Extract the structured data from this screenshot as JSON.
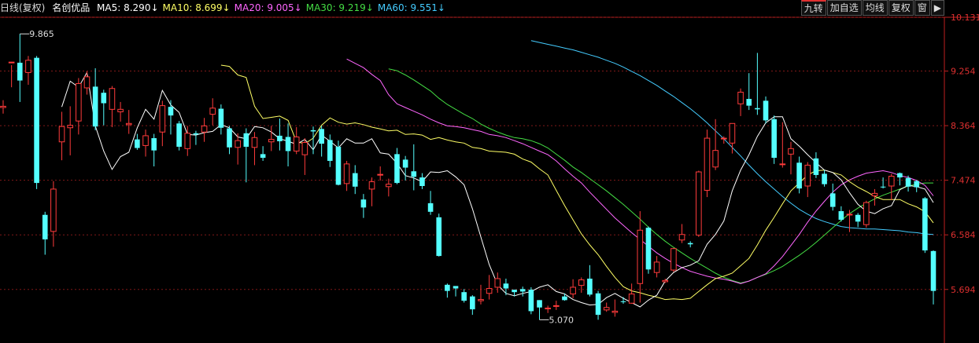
{
  "header": {
    "title": "日线(复权)",
    "stock": "名创优品",
    "ma": [
      {
        "label": "MA5:",
        "value": "8.290",
        "arrow": "↓",
        "color": "#ffffff"
      },
      {
        "label": "MA10:",
        "value": "8.699",
        "arrow": "↓",
        "color": "#ffff66"
      },
      {
        "label": "MA20:",
        "value": "9.005",
        "arrow": "↓",
        "color": "#ff66ff"
      },
      {
        "label": "MA30:",
        "value": "9.219",
        "arrow": "↓",
        "color": "#44dd44"
      },
      {
        "label": "MA60:",
        "value": "9.551",
        "arrow": "↓",
        "color": "#44ccff"
      }
    ]
  },
  "toolbar": [
    "九转",
    "加自选",
    "均线",
    "复权",
    "窗",
    "▶"
  ],
  "colors": {
    "up": "#ff3b3b",
    "down": "#54ffff",
    "axis": "#c02020",
    "grid": "#801818"
  },
  "chart_data": {
    "type": "candlestick",
    "ylim": [
      5.0,
      10.131
    ],
    "yticks": [
      "10.131",
      "9.254",
      "8.364",
      "7.474",
      "6.584",
      "5.694"
    ],
    "annotations": {
      "high": "9.865",
      "low": "5.070"
    },
    "candles": [
      [
        8.66,
        8.68,
        8.56,
        8.78
      ],
      [
        9.39,
        9.4,
        8.99,
        9.35
      ],
      [
        9.39,
        9.1,
        8.75,
        9.86
      ],
      [
        9.23,
        9.43,
        9.03,
        9.5
      ],
      [
        9.47,
        7.43,
        7.33,
        9.5
      ],
      [
        6.91,
        6.51,
        6.26,
        6.96
      ],
      [
        6.64,
        7.33,
        6.39,
        7.46
      ],
      [
        8.1,
        8.35,
        7.8,
        8.59
      ],
      [
        8.33,
        8.37,
        7.88,
        8.68
      ],
      [
        8.44,
        9.05,
        8.22,
        9.14
      ],
      [
        8.98,
        9.16,
        8.87,
        9.25
      ],
      [
        9.0,
        8.35,
        8.29,
        9.3
      ],
      [
        8.9,
        8.73,
        8.37,
        8.95
      ],
      [
        8.63,
        8.97,
        8.34,
        9.01
      ],
      [
        8.59,
        8.63,
        8.43,
        8.75
      ],
      [
        8.38,
        8.4,
        8.23,
        8.62
      ],
      [
        8.14,
        8.0,
        7.97,
        8.23
      ],
      [
        8.04,
        8.2,
        7.86,
        8.3
      ],
      [
        8.16,
        7.96,
        7.7,
        8.23
      ],
      [
        8.26,
        8.69,
        8.03,
        8.77
      ],
      [
        8.67,
        8.53,
        8.22,
        8.78
      ],
      [
        8.4,
        8.02,
        7.96,
        8.44
      ],
      [
        7.99,
        8.24,
        7.87,
        8.36
      ],
      [
        8.24,
        8.22,
        8.05,
        8.28
      ],
      [
        8.26,
        8.36,
        8.1,
        8.49
      ],
      [
        8.55,
        8.65,
        8.37,
        8.81
      ],
      [
        8.64,
        8.33,
        8.22,
        8.71
      ],
      [
        8.32,
        8.01,
        7.9,
        8.36
      ],
      [
        8.01,
        8.12,
        7.73,
        8.24
      ],
      [
        8.24,
        8.02,
        7.44,
        8.32
      ],
      [
        8.01,
        8.17,
        7.72,
        8.26
      ],
      [
        7.9,
        7.84,
        7.79,
        8.03
      ],
      [
        8.1,
        8.14,
        7.95,
        8.36
      ],
      [
        8.2,
        8.11,
        7.96,
        8.48
      ],
      [
        8.18,
        7.95,
        7.7,
        8.4
      ],
      [
        7.95,
        8.18,
        7.9,
        8.34
      ],
      [
        7.89,
        8.09,
        7.56,
        8.16
      ],
      [
        8.29,
        8.27,
        7.9,
        8.35
      ],
      [
        8.31,
        8.07,
        7.86,
        8.36
      ],
      [
        8.13,
        7.79,
        7.69,
        8.22
      ],
      [
        8.02,
        7.4,
        7.39,
        8.12
      ],
      [
        7.42,
        7.74,
        7.3,
        7.79
      ],
      [
        7.59,
        7.37,
        7.25,
        7.72
      ],
      [
        7.16,
        7.03,
        6.86,
        7.25
      ],
      [
        7.33,
        7.45,
        7.05,
        7.52
      ],
      [
        7.56,
        7.57,
        7.47,
        7.7
      ],
      [
        7.37,
        7.41,
        7.21,
        7.5
      ],
      [
        7.9,
        7.43,
        7.41,
        8.0
      ],
      [
        7.81,
        7.68,
        7.47,
        7.87
      ],
      [
        7.62,
        7.53,
        7.31,
        8.06
      ],
      [
        7.52,
        7.38,
        7.33,
        7.59
      ],
      [
        7.1,
        6.96,
        6.91,
        7.3
      ],
      [
        6.87,
        6.24,
        6.23,
        6.93
      ],
      [
        5.77,
        5.67,
        5.56,
        5.79
      ],
      [
        5.75,
        5.71,
        5.58,
        5.73
      ],
      [
        5.65,
        5.51,
        5.48,
        5.7
      ],
      [
        5.58,
        5.37,
        5.28,
        5.6
      ],
      [
        5.51,
        5.53,
        5.45,
        5.77
      ],
      [
        5.63,
        5.71,
        5.53,
        5.93
      ],
      [
        5.73,
        5.87,
        5.64,
        5.97
      ],
      [
        5.79,
        5.71,
        5.6,
        5.87
      ],
      [
        5.69,
        5.65,
        5.58,
        5.69
      ],
      [
        5.7,
        5.66,
        5.58,
        5.74
      ],
      [
        5.69,
        5.34,
        5.29,
        5.73
      ],
      [
        5.52,
        5.4,
        5.2,
        5.52
      ],
      [
        5.38,
        5.39,
        5.31,
        5.43
      ],
      [
        5.42,
        5.43,
        5.36,
        5.51
      ],
      [
        5.58,
        5.52,
        5.51,
        5.63
      ],
      [
        5.62,
        5.73,
        5.55,
        5.86
      ],
      [
        5.76,
        5.85,
        5.64,
        5.89
      ],
      [
        5.87,
        5.61,
        5.58,
        6.09
      ],
      [
        5.63,
        5.28,
        5.2,
        5.67
      ],
      [
        5.36,
        5.4,
        5.33,
        5.48
      ],
      [
        5.32,
        5.34,
        5.25,
        5.53
      ],
      [
        5.5,
        5.49,
        5.46,
        5.57
      ],
      [
        5.47,
        5.62,
        5.46,
        5.79
      ],
      [
        5.79,
        6.66,
        5.48,
        6.97
      ],
      [
        6.7,
        6.02,
        5.95,
        6.72
      ],
      [
        5.97,
        6.14,
        5.89,
        6.24
      ],
      [
        5.82,
        5.84,
        5.8,
        5.87
      ],
      [
        6.01,
        6.36,
        5.98,
        6.37
      ],
      [
        6.5,
        6.59,
        6.45,
        6.76
      ],
      [
        6.45,
        6.43,
        6.38,
        6.48
      ],
      [
        6.58,
        7.61,
        6.55,
        7.63
      ],
      [
        7.31,
        8.16,
        7.2,
        8.3
      ],
      [
        7.69,
        7.96,
        7.64,
        8.47
      ],
      [
        8.15,
        8.16,
        8.07,
        8.19
      ],
      [
        8.08,
        8.4,
        7.91,
        8.39
      ],
      [
        8.72,
        8.91,
        8.52,
        8.97
      ],
      [
        8.8,
        8.69,
        8.62,
        9.22
      ],
      [
        8.65,
        8.63,
        8.54,
        9.55
      ],
      [
        8.77,
        8.45,
        8.4,
        8.84
      ],
      [
        8.47,
        7.84,
        7.74,
        8.53
      ],
      [
        7.73,
        7.74,
        7.68,
        8.42
      ],
      [
        7.9,
        7.99,
        7.57,
        8.1
      ],
      [
        7.76,
        7.34,
        7.26,
        7.86
      ],
      [
        7.38,
        7.72,
        7.2,
        7.77
      ],
      [
        7.83,
        7.56,
        7.51,
        7.93
      ],
      [
        7.58,
        7.41,
        7.37,
        7.64
      ],
      [
        7.26,
        7.04,
        6.98,
        7.42
      ],
      [
        6.97,
        6.83,
        6.8,
        7.05
      ],
      [
        6.91,
        6.92,
        6.63,
        6.99
      ],
      [
        6.91,
        6.8,
        6.71,
        6.94
      ],
      [
        6.75,
        7.11,
        6.7,
        7.14
      ],
      [
        7.22,
        7.26,
        7.06,
        7.33
      ],
      [
        7.37,
        7.36,
        7.34,
        7.52
      ],
      [
        7.38,
        7.54,
        7.15,
        7.58
      ],
      [
        7.59,
        7.52,
        7.39,
        7.6
      ],
      [
        7.51,
        7.37,
        7.29,
        7.55
      ],
      [
        7.46,
        7.36,
        7.28,
        7.48
      ],
      [
        7.18,
        6.33,
        6.29,
        7.2
      ],
      [
        6.32,
        5.67,
        5.45,
        6.33
      ]
    ],
    "ma5": [
      8.67,
      9.09,
      8.99,
      9.23,
      8.36,
      7.95,
      7.65,
      7.86,
      7.93,
      8.33,
      8.63,
      8.47,
      8.94,
      8.7,
      8.58,
      8.22,
      8.21,
      8.25,
      8.27,
      8.38,
      8.33,
      8.18,
      8.15,
      8.35,
      8.33,
      8.26,
      8.15,
      8.11,
      8.06,
      8.14,
      7.97,
      8.21,
      8.11,
      8.0,
      8.15,
      8.08,
      8.08,
      8.15,
      7.92,
      7.9,
      7.75,
      7.55,
      7.51,
      7.45,
      7.61,
      7.6,
      7.63,
      7.53,
      7.4,
      7.01,
      6.55,
      6.1,
      5.77,
      5.63,
      5.59,
      5.63,
      5.66,
      5.73,
      5.77,
      5.66,
      5.62,
      5.53,
      5.48,
      5.44,
      5.45,
      5.56,
      5.63,
      5.55,
      5.48,
      5.41,
      5.52,
      5.6,
      5.83,
      5.97,
      6.05,
      6.09,
      6.16,
      6.43,
      6.59,
      6.81,
      7.3,
      7.64,
      7.89,
      8.19,
      8.41,
      8.51,
      8.51,
      8.15,
      8.03,
      7.89,
      7.76,
      7.64,
      7.6,
      7.48,
      7.27,
      7.08,
      6.97,
      6.93,
      7.01,
      7.06,
      7.32,
      7.39,
      7.37,
      7.33,
      7.11
    ],
    "ma10": [
      9.35,
      9.33,
      9.19,
      9.15,
      8.68,
      8.48,
      8.5,
      8.52,
      8.45,
      8.1,
      8.07,
      8.16,
      8.37,
      8.49,
      8.42,
      8.39,
      8.41,
      8.38,
      8.34,
      8.31,
      8.28,
      8.29,
      8.22,
      8.23,
      8.21,
      8.14,
      8.17,
      8.13,
      8.1,
      8.08,
      8.01,
      7.99,
      7.95,
      7.94,
      7.93,
      7.9,
      7.82,
      7.77,
      7.66,
      7.56,
      7.31,
      7.06,
      6.83,
      6.6,
      6.42,
      6.26,
      6.07,
      5.89,
      5.74,
      5.67,
      5.64,
      5.6,
      5.57,
      5.53,
      5.54,
      5.53,
      5.55,
      5.66,
      5.77,
      5.87,
      5.91,
      5.96,
      6.08,
      6.2,
      6.42,
      6.66,
      6.87,
      7.09,
      7.3,
      7.43,
      7.56,
      7.63,
      7.64,
      7.6,
      7.56,
      7.45,
      7.36,
      7.29,
      7.21,
      7.16,
      7.16,
      7.16,
      7.09,
      7.04,
      6.96,
      6.78
    ],
    "ma20": [
      9.45,
      9.38,
      9.31,
      9.2,
      9.1,
      8.87,
      8.72,
      8.66,
      8.6,
      8.54,
      8.47,
      8.41,
      8.36,
      8.35,
      8.33,
      8.3,
      8.27,
      8.22,
      8.2,
      8.17,
      8.12,
      8.07,
      8.01,
      7.95,
      7.89,
      7.79,
      7.66,
      7.54,
      7.43,
      7.28,
      7.14,
      7.0,
      6.86,
      6.74,
      6.62,
      6.51,
      6.4,
      6.29,
      6.2,
      6.12,
      6.05,
      5.99,
      5.95,
      5.91,
      5.88,
      5.86,
      5.83,
      5.79,
      5.83,
      5.89,
      5.95,
      6.08,
      6.23,
      6.41,
      6.59,
      6.79,
      6.97,
      7.13,
      7.28,
      7.4,
      7.48,
      7.54,
      7.59,
      7.61,
      7.63,
      7.6,
      7.55,
      7.52,
      7.47,
      7.39,
      7.22
    ],
    "ma30": [
      9.29,
      9.26,
      9.19,
      9.11,
      9.02,
      8.93,
      8.81,
      8.71,
      8.63,
      8.55,
      8.48,
      8.39,
      8.32,
      8.26,
      8.21,
      8.17,
      8.15,
      8.12,
      8.07,
      8.0,
      7.9,
      7.8,
      7.69,
      7.6,
      7.5,
      7.4,
      7.3,
      7.19,
      7.08,
      6.96,
      6.84,
      6.71,
      6.59,
      6.48,
      6.38,
      6.29,
      6.2,
      6.12,
      6.04,
      5.96,
      5.89,
      5.84,
      5.8,
      5.83,
      5.89,
      5.94,
      6.0,
      6.07,
      6.16,
      6.25,
      6.35,
      6.46,
      6.58,
      6.7,
      6.82,
      6.93,
      7.02,
      7.1,
      7.17,
      7.23,
      7.28,
      7.33,
      7.38,
      7.41,
      7.43,
      7.43
    ],
    "ma60": [
      9.75,
      9.72,
      9.69,
      9.66,
      9.63,
      9.6,
      9.56,
      9.52,
      9.48,
      9.43,
      9.38,
      9.32,
      9.25,
      9.18,
      9.1,
      9.02,
      8.93,
      8.84,
      8.74,
      8.64,
      8.53,
      8.41,
      8.28,
      8.15,
      8.01,
      7.87,
      7.72,
      7.58,
      7.45,
      7.33,
      7.21,
      7.1,
      7.0,
      6.92,
      6.85,
      6.8,
      6.76,
      6.72,
      6.7,
      6.69,
      6.68,
      6.68,
      6.67,
      6.66,
      6.65,
      6.63,
      6.62,
      6.6,
      6.59
    ]
  }
}
